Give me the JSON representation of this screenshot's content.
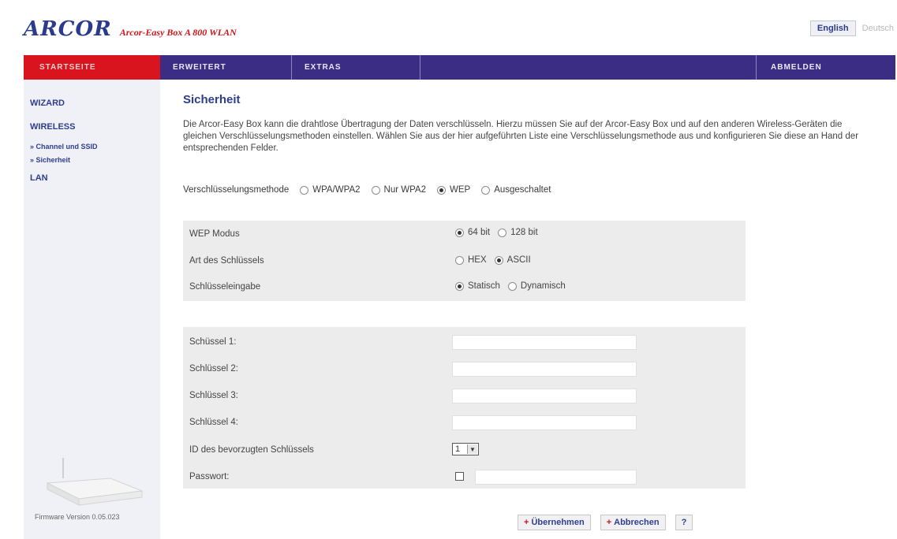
{
  "header": {
    "logo": "ARCOR",
    "logo_subtitle": "Arcor-Easy Box A 800 WLAN",
    "lang_active": "English",
    "lang_inactive": "Deutsch"
  },
  "nav": {
    "items": [
      "STARTSEITE",
      "ERWEITERT",
      "EXTRAS",
      "ABMELDEN"
    ]
  },
  "sidebar": {
    "wizard": "WIZARD",
    "wireless": "WIRELESS",
    "sub1": "» Channel und SSID",
    "sub2": "» Sicherheit",
    "lan": "LAN",
    "firmware": "Firmware Version 0.05.023"
  },
  "content": {
    "title": "Sicherheit",
    "description": "Die Arcor-Easy Box kann die drahtlose Übertragung der Daten verschlüsseln. Hierzu müssen Sie auf der Arcor-Easy Box und auf den anderen Wireless-Geräten die gleichen Verschlüsselungsmethoden einstellen. Wählen Sie aus der hier aufgeführten Liste eine Verschlüsselungsmethode aus und konfigurieren Sie diese an Hand der entsprechenden Felder.",
    "method_label": "Verschlüsselungsmethode",
    "methods": [
      "WPA/WPA2",
      "Nur WPA2",
      "WEP",
      "Ausgeschaltet"
    ],
    "method_selected": "WEP"
  },
  "wep": {
    "mode_label": "WEP Modus",
    "mode_options": [
      "64 bit",
      "128 bit"
    ],
    "key_type_label": "Art des Schlüssels",
    "key_type_options": [
      "HEX",
      "ASCII"
    ],
    "key_entry_label": "Schlüsseleingabe",
    "key_entry_options": [
      "Statisch",
      "Dynamisch"
    ]
  },
  "keys": {
    "key1": "Schüssel 1:",
    "key2": "Schlüssel 2:",
    "key3": "Schlüssel 3:",
    "key4": "Schlüssel 4:",
    "preferred_label": "ID des bevorzugten Schlüssels",
    "preferred_value": "1",
    "password_label": "Passwort:"
  },
  "buttons": {
    "apply": "Übernehmen",
    "cancel": "Abbrechen",
    "help": "?"
  }
}
